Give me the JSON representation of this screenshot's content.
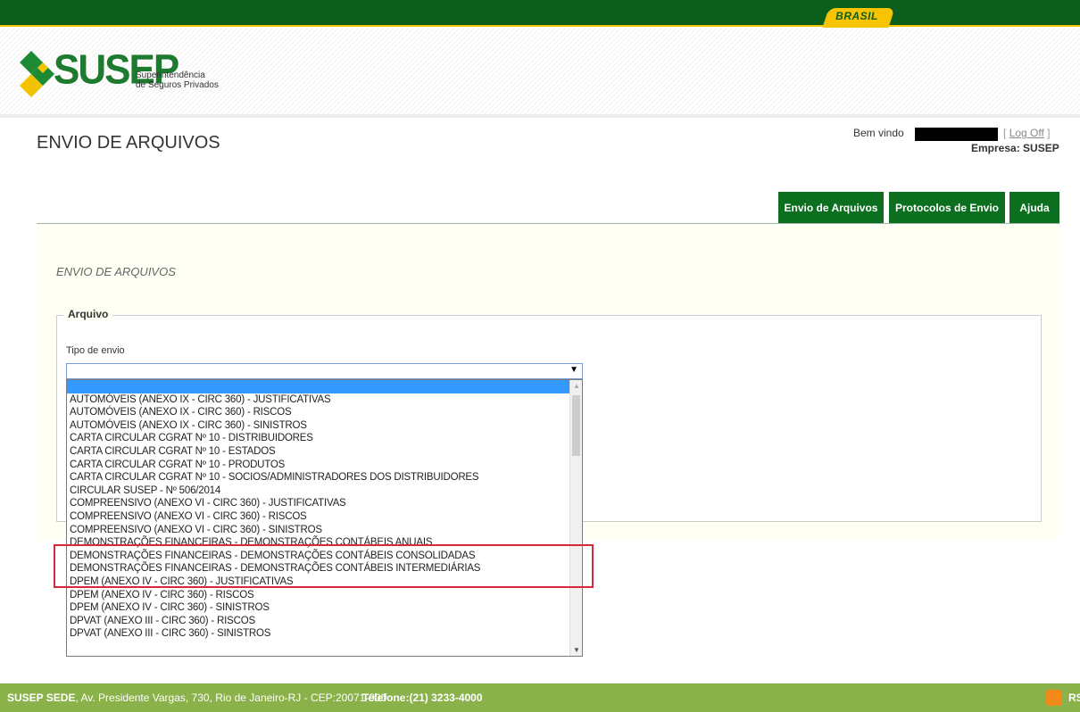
{
  "govbar": {
    "brasil": "BRASIL"
  },
  "logo": {
    "name": "SUSEP",
    "subtitle_line1": "Superintendência",
    "subtitle_line2": "de Seguros Privados"
  },
  "page": {
    "title": "ENVIO DE ARQUIVOS",
    "welcome": "Bem vindo",
    "logoff_open": "[",
    "logoff": "Log Off",
    "logoff_close": "]",
    "company": "Empresa: SUSEP"
  },
  "nav": {
    "items": [
      {
        "label": "Envio de Arquivos"
      },
      {
        "label": "Protocolos de Envio"
      },
      {
        "label": "Ajuda"
      }
    ]
  },
  "form": {
    "subtitle": "ENVIO DE ARQUIVOS",
    "legend": "Arquivo",
    "field_label": "Tipo de envio",
    "selected_value": "",
    "options": [
      "",
      "AUTOMÓVEIS (ANEXO IX - CIRC 360) - JUSTIFICATIVAS",
      "AUTOMÓVEIS (ANEXO IX - CIRC 360) - RISCOS",
      "AUTOMÓVEIS (ANEXO IX - CIRC 360) - SINISTROS",
      "CARTA CIRCULAR CGRAT Nº 10 - DISTRIBUIDORES",
      "CARTA CIRCULAR CGRAT Nº 10 - ESTADOS",
      "CARTA CIRCULAR CGRAT Nº 10 - PRODUTOS",
      "CARTA CIRCULAR CGRAT Nº 10 - SOCIOS/ADMINISTRADORES DOS DISTRIBUIDORES",
      "CIRCULAR SUSEP - Nº 506/2014",
      "COMPREENSIVO (ANEXO VI - CIRC 360) - JUSTIFICATIVAS",
      "COMPREENSIVO (ANEXO VI - CIRC 360) - RISCOS",
      "COMPREENSIVO (ANEXO VI - CIRC 360) - SINISTROS",
      "DEMONSTRAÇÕES FINANCEIRAS - DEMONSTRAÇÕES CONTÁBEIS ANUAIS",
      "DEMONSTRAÇÕES FINANCEIRAS - DEMONSTRAÇÕES CONTÁBEIS CONSOLIDADAS",
      "DEMONSTRAÇÕES FINANCEIRAS - DEMONSTRAÇÕES CONTÁBEIS INTERMEDIÁRIAS",
      "DPEM (ANEXO IV - CIRC 360) - JUSTIFICATIVAS",
      "DPEM (ANEXO IV - CIRC 360) - RISCOS",
      "DPEM (ANEXO IV - CIRC 360) - SINISTROS",
      "DPVAT (ANEXO III - CIRC 360) - RISCOS",
      "DPVAT (ANEXO III - CIRC 360) - SINISTROS"
    ]
  },
  "footer": {
    "org": "SUSEP SEDE",
    "address": ", Av. Presidente Vargas, 730, Rio de Janeiro-RJ  -  CEP:20071-900",
    "phone": "Telefone:(21) 3233-4000",
    "rss": "RS"
  },
  "colors": {
    "gov_green": "#0c5f1a",
    "nav_green": "#0c6e1f",
    "footer_green": "#8ab14a",
    "highlight_red": "#d42a3a",
    "select_blue": "#3399ff"
  }
}
